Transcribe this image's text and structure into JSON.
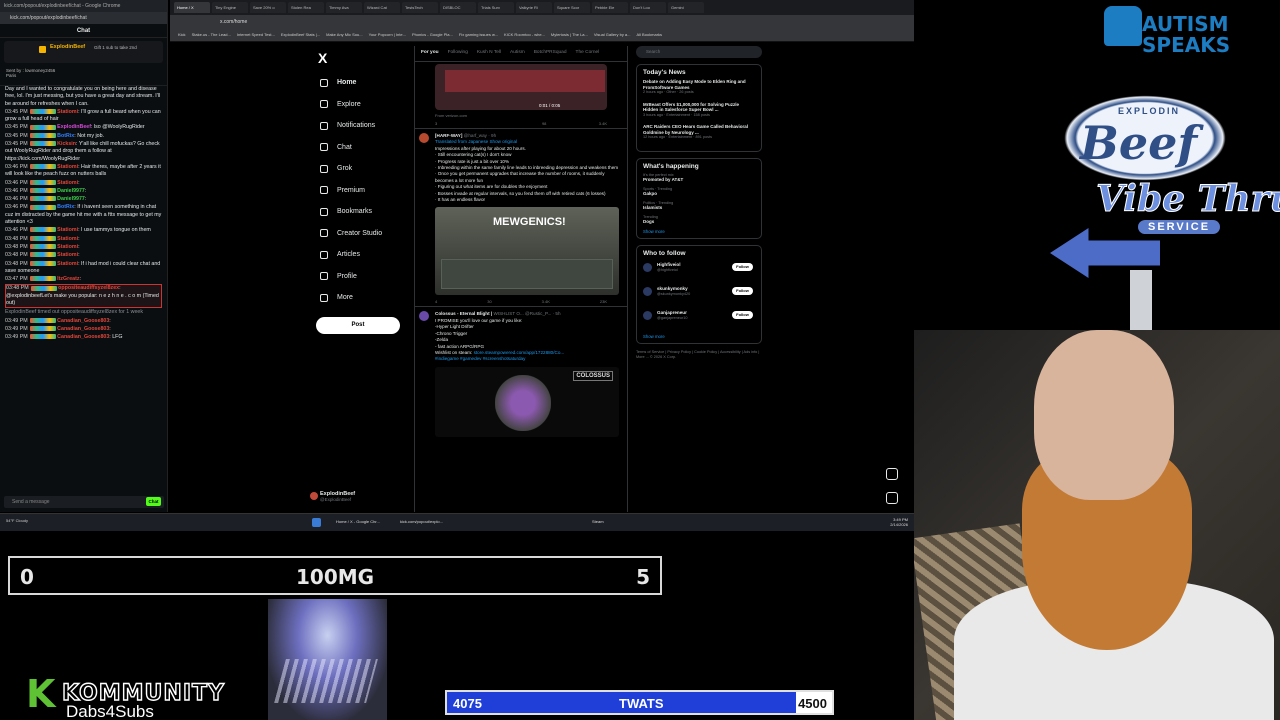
{
  "chat_window": {
    "title": "kick.com/popout/explodinbeef/chat - Google Chrome",
    "url": "kick.com/popout/explodinbeef/chat",
    "header": "Chat",
    "pinned_sender": "ExplodinBeef",
    "pinned_text": "Gift 1 sub to take 2nd",
    "sent_by": "Sent by :",
    "sent_by_name": "lowmoney2456",
    "sent_by_place": "Paris",
    "intro_text": "Day and I wanted to congratulate you on being here and disease free, lol. I'm just messing, but you have a great day and stream. I'll be around for refreshes when I can.",
    "messages": [
      {
        "time": "03:45 PM",
        "user": "Statiomi",
        "text": "I'll grow a full beard when you can grow a full head of hair",
        "color": "#e0463a"
      },
      {
        "time": "03:45 PM",
        "user": "ExplodinBeef",
        "text": "lso @WoolyRugRider",
        "color": "#d54ad8"
      },
      {
        "time": "03:45 PM",
        "user": "BotRix",
        "text": "Not my job.",
        "color": "#2f80ff"
      },
      {
        "time": "03:45 PM",
        "user": "Kicksin",
        "text": "Y'all like chill mofuckas? Go check out WoolyRugRider and drop them a follow at https://kick.com/WoolyRugRider",
        "color": "#e0463a"
      },
      {
        "time": "03:46 PM",
        "user": "Statiomi",
        "text": "Hair theres, maybe after 2 years it will look like the peach fuzz on nutters balls",
        "color": "#e0463a"
      },
      {
        "time": "03:46 PM",
        "user": "Statiomi",
        "text": "",
        "color": "#e0463a"
      },
      {
        "time": "03:46 PM",
        "user": "Daniel9977",
        "text": "",
        "color": "#3bd14a"
      },
      {
        "time": "03:46 PM",
        "user": "Daniel9977",
        "text": "",
        "color": "#3bd14a"
      },
      {
        "time": "03:46 PM",
        "user": "BotRix",
        "text": "If i havent seen something in chat cuz im distracted by the game hit me with a ftts message to get my attention <3",
        "color": "#2f80ff"
      },
      {
        "time": "03:46 PM",
        "user": "Statiomi",
        "text": "I use tammys tongue on them",
        "color": "#e0463a"
      },
      {
        "time": "03:48 PM",
        "user": "Statiomi",
        "text": "",
        "color": "#e0463a"
      },
      {
        "time": "03:48 PM",
        "user": "Statiomi",
        "text": "",
        "color": "#e0463a"
      },
      {
        "time": "03:48 PM",
        "user": "Statiomi",
        "text": "",
        "color": "#e0463a"
      },
      {
        "time": "03:48 PM",
        "user": "Statiomi",
        "text": "If i had mod i could clear chat and save someone",
        "color": "#e0463a"
      },
      {
        "time": "03:47 PM",
        "user": "ItzGreatz",
        "text": "",
        "color": "#e0463a"
      }
    ],
    "timeout_msg": {
      "time": "03:48 PM",
      "user": "oppositeaudiffsyzel8zex",
      "mention": "@explodinbeef",
      "text": "Let's make you popular: n e z h n e . c o m",
      "tag": "(Timed out)"
    },
    "timeout_notice": "ExplodinBeef timed out oppositeaudiffsyzel8zex for 1 week",
    "late_msgs": [
      {
        "time": "03:49 PM",
        "user": "Canadian_Goose803",
        "text": ""
      },
      {
        "time": "03:49 PM",
        "user": "Canadian_Goose803",
        "text": ""
      },
      {
        "time": "03:49 PM",
        "user": "Canadian_Goose803",
        "text": "LFG"
      }
    ],
    "input_placeholder": "Send a message",
    "send_label": "Chat"
  },
  "browser": {
    "tabs": [
      "Home / X",
      "Tiny Engine",
      "Save 20% o",
      "Stolen Rea",
      "Timmy Ava",
      "Wizard Cat",
      "TestsTech",
      "DISBLOC",
      "Trials Surv",
      "Valkyrie Ri",
      "Square Scor",
      "Pebble Ele",
      "Don't Loo",
      "Gemini"
    ],
    "address": "x.com/home",
    "bookmarks": [
      "Kick",
      "Stake.us - The Lead...",
      "Internet Speed Test...",
      "ExplodinBeef Stats |...",
      "Make Any Mic Sou...",
      "Your Popcorn | Inte...",
      "Phonics - Google Pla...",
      "Fix gaming issues w...",
      "KICK Roomtoo - whe...",
      "Mylertosis | The La...",
      "Visual Gallery by a...",
      "All Bookmarks"
    ]
  },
  "x_nav": {
    "logo": "X",
    "items": [
      {
        "label": "Home",
        "icon": "home-icon"
      },
      {
        "label": "Explore",
        "icon": "search-icon"
      },
      {
        "label": "Notifications",
        "icon": "bell-icon"
      },
      {
        "label": "Chat",
        "icon": "chat-icon"
      },
      {
        "label": "Grok",
        "icon": "grok-icon"
      },
      {
        "label": "Premium",
        "icon": "x-icon"
      },
      {
        "label": "Bookmarks",
        "icon": "bookmark-icon"
      },
      {
        "label": "Creator Studio",
        "icon": "studio-icon"
      },
      {
        "label": "Articles",
        "icon": "articles-icon"
      },
      {
        "label": "Profile",
        "icon": "person-icon"
      },
      {
        "label": "More",
        "icon": "more-icon"
      }
    ],
    "post_label": "Post",
    "account_name": "ExplodinBeef",
    "account_handle": "@ExplodinBeef"
  },
  "feed": {
    "tabs": [
      "For you",
      "Following",
      "Kush N Tell",
      "Autism",
      "BotchPRSquad",
      "The Cornel"
    ],
    "video_time": "0:01 / 0:05",
    "video_source": "From verizon.com",
    "video_actions": [
      "3",
      "",
      "98",
      "3.4K"
    ],
    "tweet1": {
      "name": "[HARF-WAY]",
      "handle": "@harf_way · 9h",
      "translated": "Translated from Japanese Show original",
      "lines": [
        "Impressions after playing for about 20 hours.",
        "· Still encountering cat(s) I don't know",
        "· Progress rate is just a bit over 10%",
        "· Inbreeding within the same family line leads to inbreeding depression and weakens them",
        "· Once you get permanent upgrades that increase the number of rooms, it suddenly becomes a lot more fun",
        "· Figuring out what items are for doubles the enjoyment",
        "· Bosses invade at regular intervals, so you fend them off with retired cats (6 losses)",
        "· It has an endless flavor"
      ],
      "image_title": "MEWGENICS!",
      "actions": [
        "4",
        "30",
        "3.4K",
        "23K"
      ]
    },
    "tweet2": {
      "name": "Colossus - Eternal Blight |",
      "handle": "WISHLIST O... @Rustic_P... · 5h",
      "lines": [
        "I PROMISE you'll love our game if you like:",
        "-Hyper Light Drifter",
        "-Chrono Trigger",
        "-Zelda",
        "- fast action ARPG/RPG"
      ],
      "wishlist": "Wishlist on steam:",
      "wishlist_link": "store.steampowered.com/app/1722880/Co...",
      "hashtags": "#indiegame #gamedev #screenshotsaturday",
      "image_logo": "COLOSSUS"
    }
  },
  "right_sidebar": {
    "search_placeholder": "Search",
    "news_title": "Today's News",
    "news": [
      {
        "title": "Debate on Adding Easy Mode to Elden Ring and FromSoftware Games",
        "meta": "2 hours ago · Other · 26 posts"
      },
      {
        "title": "MrBeast Offers $1,000,000 for Solving Puzzle Hidden in Salesforce Super Bowl ...",
        "meta": "3 hours ago · Entertainment · 158 posts"
      },
      {
        "title": "ARC Raiders CEO Hears Game Called Behavioral Goldmine by Neurology ...",
        "meta": "12 hours ago · Entertainment · 891 posts"
      }
    ],
    "happening_title": "What's happening",
    "trends": [
      {
        "context": "It's the perfect mix",
        "name": "Promoted by AT&T"
      },
      {
        "context": "Sports · Trending",
        "name": "Gakpo"
      },
      {
        "context": "Politics · Trending",
        "name": "Islamists"
      },
      {
        "context": "Trending",
        "name": "Dogs"
      }
    ],
    "show_more": "Show more",
    "follow_title": "Who to follow",
    "follows": [
      {
        "name": "Highfiveiol",
        "handle": "@highfiveiol"
      },
      {
        "name": "skunkymonky",
        "handle": "@skunkymonky420"
      },
      {
        "name": "Ganjapreneur",
        "handle": "@ganjapreneur10"
      }
    ],
    "follow_label": "Follow",
    "footer": "Terms of Service | Privacy Policy | Cookie Policy | Accessibility | Ads info | More ... © 2026 X Corp."
  },
  "taskbar": {
    "weather": "54°F Cloudy",
    "app1": "Home / X - Google Chr...",
    "app2": "kick.com/popout/explo...",
    "app3": "Steam",
    "time": "3:49 PM",
    "date": "2/14/2026"
  },
  "overlays": {
    "counter_left": "0",
    "counter_mid": "100MG",
    "counter_right": "5",
    "kommunity": "KOMMUNITY",
    "kommunity_k": "K",
    "kommunity_sub": "Dabs4Subs",
    "goal_start": "4075",
    "goal_label": "TWATS",
    "goal_end": "4500",
    "goal_fraction": 0.906,
    "autism_line1": "AUTISM",
    "autism_line2": "SPEAKS",
    "beef_top": "EXPLODIN",
    "beef_word": "Beef",
    "vibe": "Vibe Thru",
    "service": "SERVICE"
  }
}
